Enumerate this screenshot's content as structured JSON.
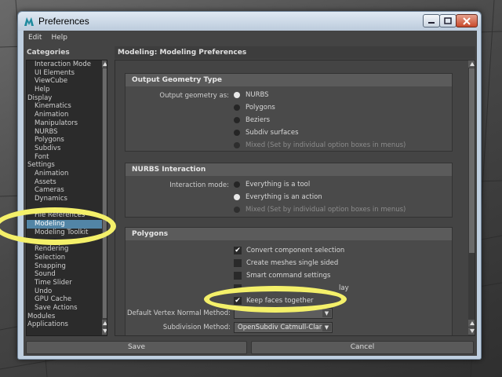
{
  "window": {
    "title": "Preferences",
    "colors": {
      "selection": "#5285a6",
      "annotation": "#f4f06a"
    }
  },
  "menu": [
    "Edit",
    "Help"
  ],
  "categories": {
    "header": "Categories",
    "selected": "Modeling",
    "items": [
      {
        "label": "Interaction Mode",
        "level": "sub"
      },
      {
        "label": "UI Elements",
        "level": "sub"
      },
      {
        "label": "ViewCube",
        "level": "sub"
      },
      {
        "label": "Help",
        "level": "sub"
      },
      {
        "label": "Display",
        "level": "top"
      },
      {
        "label": "Kinematics",
        "level": "sub"
      },
      {
        "label": "Animation",
        "level": "sub"
      },
      {
        "label": "Manipulators",
        "level": "sub"
      },
      {
        "label": "NURBS",
        "level": "sub"
      },
      {
        "label": "Polygons",
        "level": "sub"
      },
      {
        "label": "Subdivs",
        "level": "sub"
      },
      {
        "label": "Font",
        "level": "sub"
      },
      {
        "label": "Settings",
        "level": "top"
      },
      {
        "label": "Animation",
        "level": "sub"
      },
      {
        "label": "Assets",
        "level": "sub"
      },
      {
        "label": "Cameras",
        "level": "sub"
      },
      {
        "label": "Dynamics",
        "level": "sub"
      },
      {
        "label": "",
        "level": "sub"
      },
      {
        "label": "File References",
        "level": "sub"
      },
      {
        "label": "Modeling",
        "level": "sub"
      },
      {
        "label": "Modeling Toolkit",
        "level": "sub"
      },
      {
        "label": "",
        "level": "sub"
      },
      {
        "label": "Rendering",
        "level": "sub"
      },
      {
        "label": "Selection",
        "level": "sub"
      },
      {
        "label": "Snapping",
        "level": "sub"
      },
      {
        "label": "Sound",
        "level": "sub"
      },
      {
        "label": "Time Slider",
        "level": "sub"
      },
      {
        "label": "Undo",
        "level": "sub"
      },
      {
        "label": "GPU Cache",
        "level": "sub"
      },
      {
        "label": "Save Actions",
        "level": "sub"
      },
      {
        "label": "Modules",
        "level": "top"
      },
      {
        "label": "Applications",
        "level": "top"
      }
    ]
  },
  "main": {
    "header": "Modeling: Modeling Preferences",
    "output_geometry": {
      "title": "Output Geometry Type",
      "label": "Output geometry as:",
      "options": [
        {
          "label": "NURBS",
          "state": "on"
        },
        {
          "label": "Polygons",
          "state": "off"
        },
        {
          "label": "Beziers",
          "state": "off"
        },
        {
          "label": "Subdiv surfaces",
          "state": "off"
        },
        {
          "label": "Mixed (Set by individual option boxes in menus)",
          "state": "disabled"
        }
      ]
    },
    "nurbs_interaction": {
      "title": "NURBS Interaction",
      "label": "Interaction mode:",
      "options": [
        {
          "label": "Everything is a tool",
          "state": "off"
        },
        {
          "label": "Everything is an action",
          "state": "on"
        },
        {
          "label": "Mixed (Set by individual option boxes in menus)",
          "state": "disabled"
        }
      ]
    },
    "polygons": {
      "title": "Polygons",
      "checks": [
        {
          "label": "Convert component selection",
          "checked": true
        },
        {
          "label": "Create meshes single sided",
          "checked": false
        },
        {
          "label": "Smart command settings",
          "checked": false
        },
        {
          "label": "lay",
          "checked": false
        },
        {
          "label": "Keep faces together",
          "checked": true
        }
      ],
      "default_vertex_normal_label": "Default Vertex Normal Method:",
      "subdivision_label": "Subdivision Method:",
      "subdivision_value": "OpenSubdiv Catmull-Clark"
    }
  },
  "buttons": {
    "save": "Save",
    "cancel": "Cancel"
  }
}
